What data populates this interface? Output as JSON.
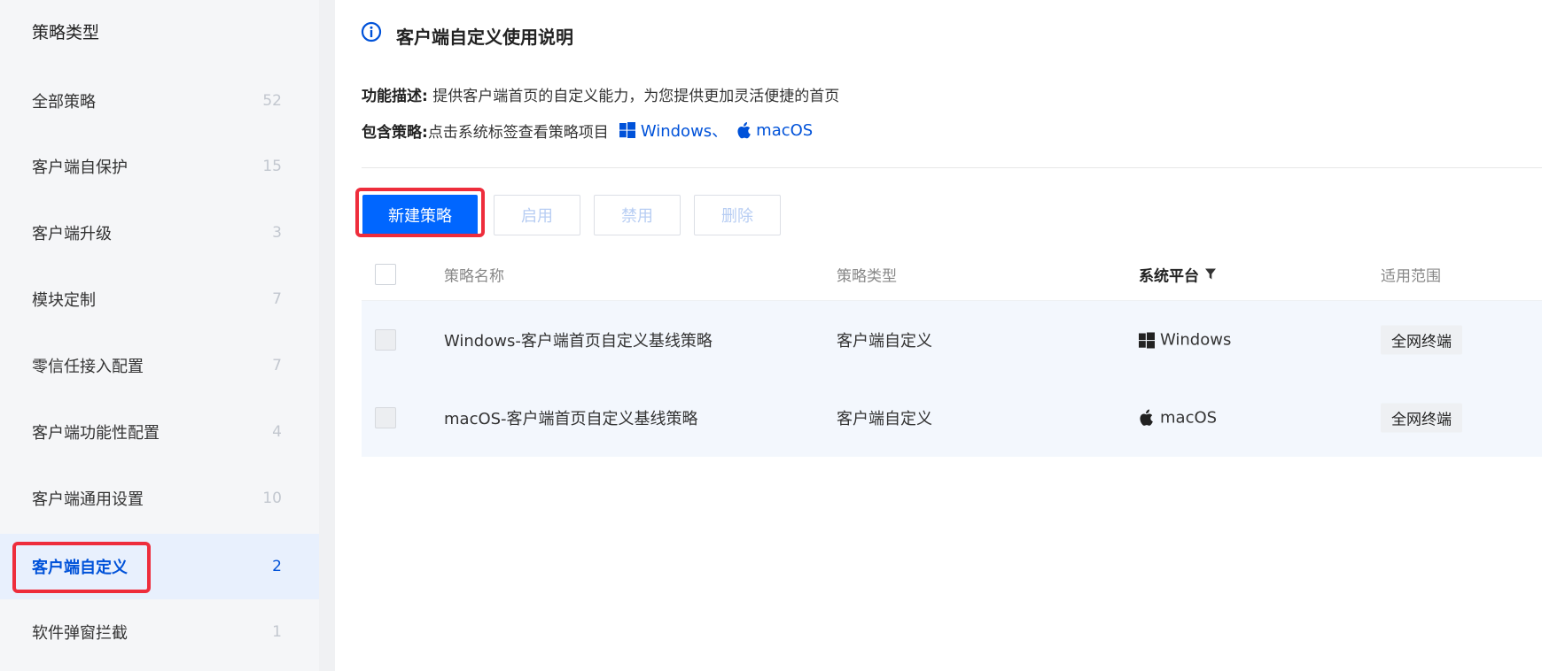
{
  "sidebar": {
    "header": "策略类型",
    "items": [
      {
        "label": "全部策略",
        "count": "52"
      },
      {
        "label": "客户端自保护",
        "count": "15"
      },
      {
        "label": "客户端升级",
        "count": "3"
      },
      {
        "label": "模块定制",
        "count": "7"
      },
      {
        "label": "零信任接入配置",
        "count": "7"
      },
      {
        "label": "客户端功能性配置",
        "count": "4"
      },
      {
        "label": "客户端通用设置",
        "count": "10"
      },
      {
        "label": "客户端自定义",
        "count": "2",
        "active": true
      },
      {
        "label": "软件弹窗拦截",
        "count": "1"
      }
    ]
  },
  "info": {
    "title": "客户端自定义使用说明",
    "desc_label": "功能描述:",
    "desc_text": "提供客户端首页的自定义能力，为您提供更加灵活便捷的首页",
    "policy_label": "包含策略:",
    "policy_text": "点击系统标签查看策略项目",
    "windows_link": "Windows、",
    "macos_link": "macOS"
  },
  "toolbar": {
    "new_label": "新建策略",
    "enable_label": "启用",
    "disable_label": "禁用",
    "delete_label": "删除"
  },
  "table": {
    "columns": {
      "name": "策略名称",
      "type": "策略类型",
      "platform": "系统平台",
      "scope": "适用范围"
    },
    "rows": [
      {
        "name": "Windows-客户端首页自定义基线策略",
        "type": "客户端自定义",
        "platform": "Windows",
        "platform_icon": "windows-icon",
        "scope": "全网终端"
      },
      {
        "name": "macOS-客户端首页自定义基线策略",
        "type": "客户端自定义",
        "platform": "macOS",
        "platform_icon": "apple-icon",
        "scope": "全网终端"
      }
    ]
  },
  "colors": {
    "accent": "#0052d9",
    "primary_button": "#0066ff",
    "highlight": "#ee2d3c",
    "row_bg": "#f3f7fd",
    "active_bg": "#e8f0fd"
  }
}
